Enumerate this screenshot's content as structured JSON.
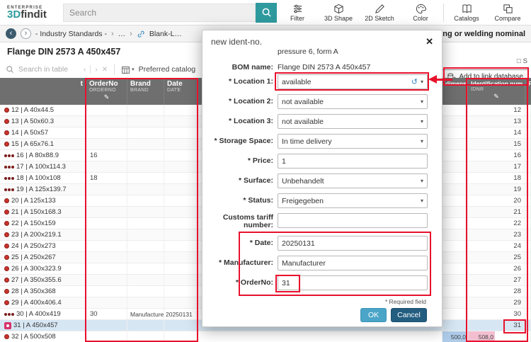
{
  "topbar": {
    "brand": {
      "enterprise": "ENTERPRISE",
      "logo_3d": "3D",
      "logo_findit": "findit"
    },
    "search": {
      "placeholder": "Search"
    },
    "tools": [
      {
        "label": "Filter"
      },
      {
        "label": "3D Shape"
      },
      {
        "label": "2D Sketch"
      },
      {
        "label": "Color"
      },
      {
        "label": "Catalogs"
      },
      {
        "label": "Compare"
      }
    ]
  },
  "navbar": {
    "crumb1": "- Industry Standards -",
    "crumb_ellipsis": "…",
    "crumb2": "Blank-L…",
    "right_text": "or soldering or welding nominal"
  },
  "panel": {
    "title": "Flange DIN 2573 A 450x457",
    "table_search_placeholder": "Search in table",
    "preferred_catalog": "Preferred catalog",
    "add_link_button": "Add to link database",
    "partial_label": "S"
  },
  "table": {
    "headers_left": {
      "variant": "t",
      "orderno": {
        "name": "OrderNo",
        "sub": "ORDERNO"
      },
      "brand": {
        "name": "Brand",
        "sub": "BRAND"
      },
      "date": {
        "name": "Date",
        "sub": "DATE"
      }
    },
    "headers_right": {
      "dimens": "dimens…",
      "idnr": {
        "name": "Identification num…",
        "sub": "IDNR"
      },
      "fla": "Fla…"
    },
    "rows": [
      {
        "item": "12 | A 40x44.5",
        "marker": "single",
        "orderno": "",
        "brand": "",
        "date": "",
        "idnr": "12"
      },
      {
        "item": "13 | A 50x60.3",
        "marker": "single",
        "orderno": "",
        "brand": "",
        "date": "",
        "idnr": "13"
      },
      {
        "item": "14 | A 50x57",
        "marker": "single",
        "orderno": "",
        "brand": "",
        "date": "",
        "idnr": "14"
      },
      {
        "item": "15 | A 65x76.1",
        "marker": "single",
        "orderno": "",
        "brand": "",
        "date": "",
        "idnr": "15"
      },
      {
        "item": "16 | A 80x88.9",
        "marker": "triple",
        "orderno": "16",
        "brand": "",
        "date": "",
        "idnr": "16"
      },
      {
        "item": "17 | A 100x114.3",
        "marker": "triple",
        "orderno": "",
        "brand": "",
        "date": "",
        "idnr": "17"
      },
      {
        "item": "18 | A 100x108",
        "marker": "triple",
        "orderno": "18",
        "brand": "",
        "date": "",
        "idnr": "18"
      },
      {
        "item": "19 | A 125x139.7",
        "marker": "triple",
        "orderno": "",
        "brand": "",
        "date": "",
        "idnr": "19"
      },
      {
        "item": "20 | A 125x133",
        "marker": "single",
        "orderno": "",
        "brand": "",
        "date": "",
        "idnr": "20"
      },
      {
        "item": "21 | A 150x168.3",
        "marker": "single",
        "orderno": "",
        "brand": "",
        "date": "",
        "idnr": "21"
      },
      {
        "item": "22 | A 150x159",
        "marker": "single",
        "orderno": "",
        "brand": "",
        "date": "",
        "idnr": "22"
      },
      {
        "item": "23 | A 200x219.1",
        "marker": "single",
        "orderno": "",
        "brand": "",
        "date": "",
        "idnr": "23"
      },
      {
        "item": "24 | A 250x273",
        "marker": "single",
        "orderno": "",
        "brand": "",
        "date": "",
        "idnr": "24"
      },
      {
        "item": "25 | A 250x267",
        "marker": "single",
        "orderno": "",
        "brand": "",
        "date": "",
        "idnr": "25"
      },
      {
        "item": "26 | A 300x323.9",
        "marker": "single",
        "orderno": "",
        "brand": "",
        "date": "",
        "idnr": "26"
      },
      {
        "item": "27 | A 350x355.6",
        "marker": "single",
        "orderno": "",
        "brand": "",
        "date": "",
        "idnr": "27"
      },
      {
        "item": "28 | A 350x368",
        "marker": "single",
        "orderno": "",
        "brand": "",
        "date": "",
        "idnr": "28"
      },
      {
        "item": "29 | A 400x406.4",
        "marker": "single",
        "orderno": "",
        "brand": "",
        "date": "",
        "idnr": "29"
      },
      {
        "item": "30 | A 400x419",
        "marker": "triple",
        "orderno": "30",
        "brand": "Manufacturer",
        "date": "20250131",
        "idnr": "30"
      },
      {
        "item": "31 | A 450x457",
        "marker": "special",
        "orderno": "",
        "brand": "",
        "date": "",
        "idnr": "31",
        "selected": true
      },
      {
        "item": "32 | A 500x508",
        "marker": "single",
        "orderno": "",
        "brand": "",
        "date": "",
        "idnr": "",
        "dim1": "500,0",
        "dim2": "508,0"
      }
    ]
  },
  "modal": {
    "title": "new ident-no.",
    "description_line": "pressure 6, form A",
    "bom_label": "BOM name:",
    "bom_value": "Flange DIN 2573 A 450x457",
    "fields": [
      {
        "label": "* Location 1:",
        "value": "available",
        "type": "select"
      },
      {
        "label": "* Location 2:",
        "value": "not available",
        "type": "select"
      },
      {
        "label": "* Location 3:",
        "value": "not available",
        "type": "select"
      },
      {
        "label": "* Storage Space:",
        "value": "In time delivery",
        "type": "select"
      },
      {
        "label": "* Price:",
        "value": "1",
        "type": "input"
      },
      {
        "label": "* Surface:",
        "value": "Unbehandelt",
        "type": "select"
      },
      {
        "label": "* Status:",
        "value": "Freigegeben",
        "type": "select"
      },
      {
        "label": "Customs tariff number:",
        "value": "",
        "type": "input"
      },
      {
        "label": "* Date:",
        "value": "20250131",
        "type": "input"
      },
      {
        "label": "* Manufacturer:",
        "value": "Manufacturer",
        "type": "input"
      },
      {
        "label": "* OrderNo:",
        "value": "31",
        "type": "input"
      }
    ],
    "required_note": "* Required field",
    "ok": "OK",
    "cancel": "Cancel"
  },
  "icons": {
    "edit_pencil": "✎",
    "close": "✕",
    "reset": "↺",
    "chevron_down": "▾",
    "prev": "‹",
    "next": "›",
    "clear": "✕",
    "checkbox": "□",
    "back_arrow": "‹",
    "forward_arrow": "›",
    "crumb_sep": "›"
  },
  "colors": {
    "accent_teal": "#2e9a9e",
    "header_gray": "#6f6f6f",
    "annotation_red": "#e8112d",
    "ok_blue": "#4ba5c8",
    "cancel_navy": "#235e80",
    "selected_row": "#d7e6f3",
    "dim_blue_cell": "#aeccea",
    "dim_pink_cell": "#f3bfd0",
    "dot_red": "#c9342c",
    "dot_dark_red": "#7d1e1e",
    "special_marker_pink": "#d6336c"
  }
}
